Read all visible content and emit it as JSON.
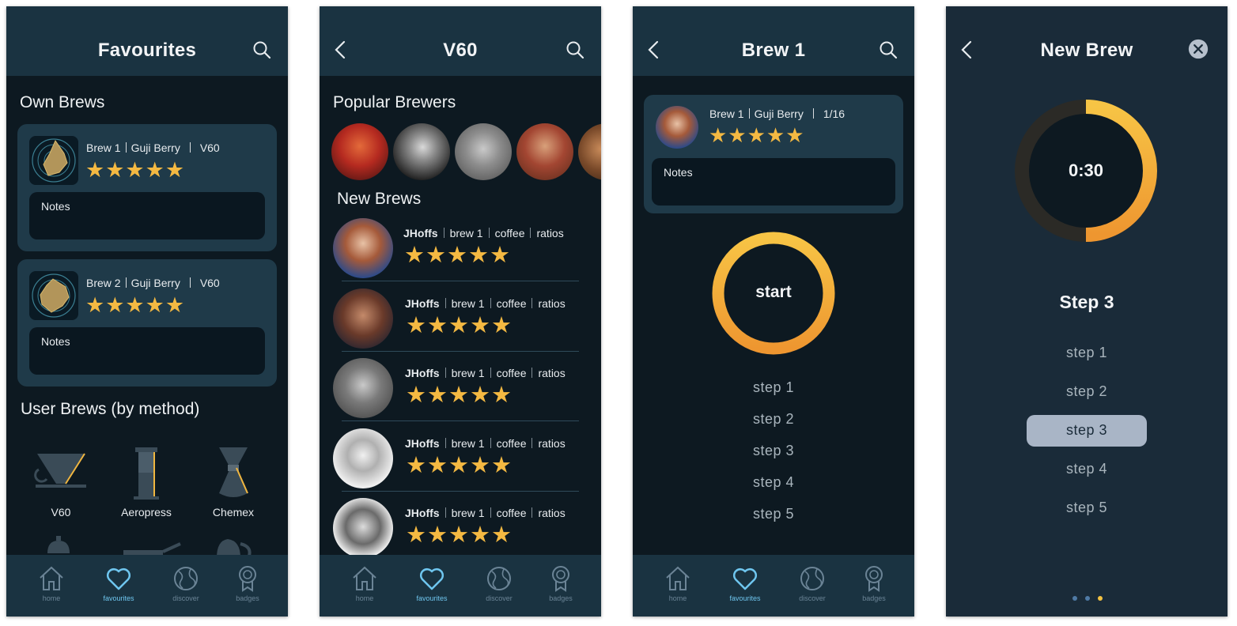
{
  "tabs": {
    "home": "home",
    "favourites": "favourites",
    "discover": "discover",
    "badges": "badges"
  },
  "screen1": {
    "title": "Favourites",
    "own_brews_heading": "Own Brews",
    "brews": [
      {
        "name": "Brew 1",
        "bean": "Guji Berry",
        "method": "V60",
        "stars": "★★★★★",
        "notes": "Notes"
      },
      {
        "name": "Brew 2",
        "bean": "Guji Berry",
        "method": "V60",
        "stars": "★★★★★",
        "notes": "Notes"
      }
    ],
    "user_brews_heading": "User Brews (by method)",
    "methods": [
      {
        "label": "V60"
      },
      {
        "label": "Aeropress"
      },
      {
        "label": "Chemex"
      }
    ]
  },
  "screen2": {
    "title": "V60",
    "popular_heading": "Popular Brewers",
    "new_brews_heading": "New Brews",
    "rows": [
      {
        "user": "JHoffs",
        "brew": "brew 1",
        "c1": "coffee",
        "c2": "ratios",
        "stars": "★★★★★"
      },
      {
        "user": "JHoffs",
        "brew": "brew 1",
        "c1": "coffee",
        "c2": "ratios",
        "stars": "★★★★★"
      },
      {
        "user": "JHoffs",
        "brew": "brew 1",
        "c1": "coffee",
        "c2": "ratios",
        "stars": "★★★★★"
      },
      {
        "user": "JHoffs",
        "brew": "brew 1",
        "c1": "coffee",
        "c2": "ratios",
        "stars": "★★★★★"
      },
      {
        "user": "JHoffs",
        "brew": "brew 1",
        "c1": "coffee",
        "c2": "ratios",
        "stars": "★★★★★"
      }
    ]
  },
  "screen3": {
    "title": "Brew 1",
    "card": {
      "name": "Brew 1",
      "bean": "Guji Berry",
      "count": "1/16",
      "stars": "★★★★★",
      "notes": "Notes"
    },
    "start": "start",
    "steps": [
      "step 1",
      "step 2",
      "step 3",
      "step 4",
      "step 5"
    ]
  },
  "screen4": {
    "title": "New Brew",
    "timer": "0:30",
    "progress": 0.5,
    "current_step": "Step 3",
    "steps": [
      "step 1",
      "step 2",
      "step 3",
      "step 4",
      "step 5"
    ],
    "selected_step_index": 2,
    "page_dots": 3,
    "active_dot": 2
  },
  "colors": {
    "header": "#1a3341",
    "background": "#0d1921",
    "accent_star": "#f4b942",
    "active_tab": "#6fc6ef",
    "ring_start": "#f7c445",
    "ring_end": "#ee9630"
  }
}
